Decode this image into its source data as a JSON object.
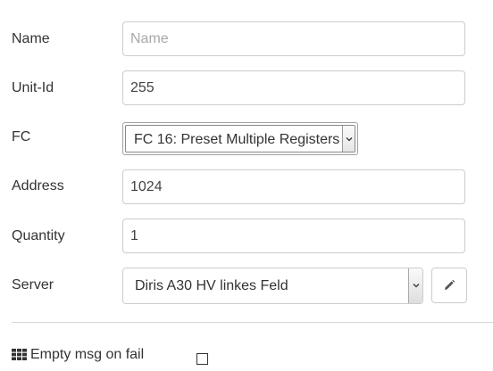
{
  "fields": {
    "name": {
      "label": "Name",
      "value": "",
      "placeholder": "Name"
    },
    "unit_id": {
      "label": "Unit-Id",
      "value": "255"
    },
    "fc": {
      "label": "FC",
      "selected": "FC 16: Preset Multiple Registers"
    },
    "address": {
      "label": "Address",
      "value": "1024"
    },
    "quantity": {
      "label": "Quantity",
      "value": "1"
    },
    "server": {
      "label": "Server",
      "selected": "Diris A30 HV linkes Feld"
    }
  },
  "options": {
    "empty_msg_on_fail": {
      "label": "Empty msg on fail",
      "checked": false
    }
  },
  "icons": {
    "edit": "pencil-icon",
    "grid": "th-grid-icon",
    "dropdown": "chevron-down-icon"
  }
}
